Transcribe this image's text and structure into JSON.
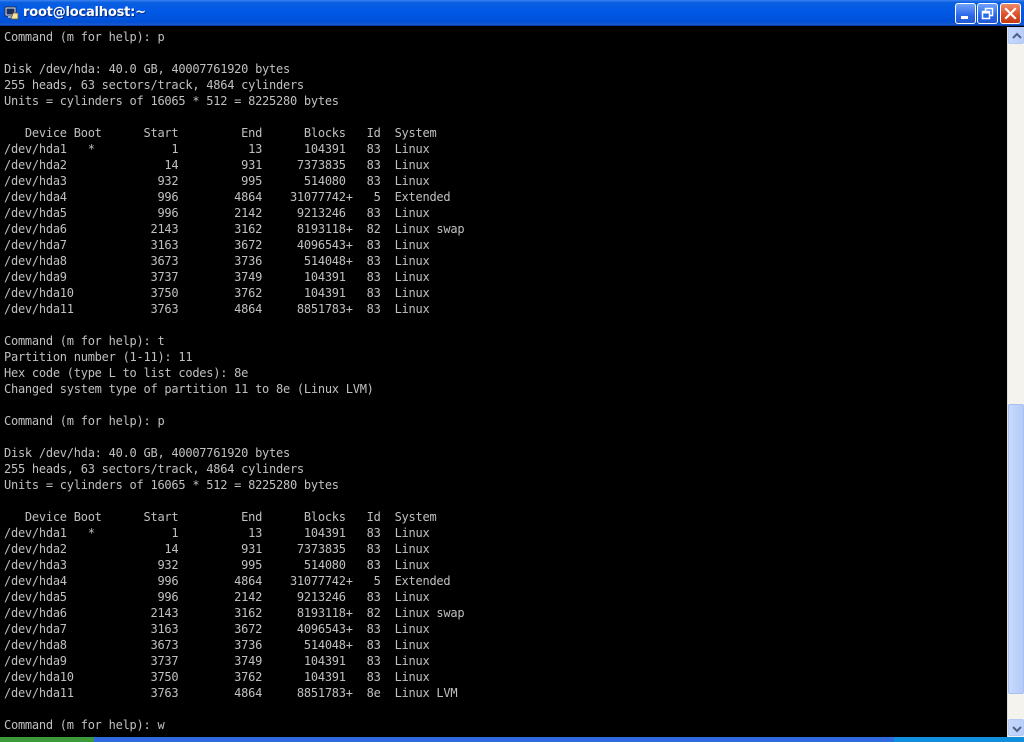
{
  "window": {
    "title": "root@localhost:~",
    "minimize_icon": "minimize-icon",
    "maximize_icon": "restore-icon",
    "close_icon": "close-icon"
  },
  "terminal": {
    "lines": [
      "Command (m for help): p",
      "",
      "Disk /dev/hda: 40.0 GB, 40007761920 bytes",
      "255 heads, 63 sectors/track, 4864 cylinders",
      "Units = cylinders of 16065 * 512 = 8225280 bytes",
      "",
      "   Device Boot      Start         End      Blocks   Id  System",
      "/dev/hda1   *           1          13      104391   83  Linux",
      "/dev/hda2              14         931     7373835   83  Linux",
      "/dev/hda3             932         995      514080   83  Linux",
      "/dev/hda4             996        4864    31077742+   5  Extended",
      "/dev/hda5             996        2142     9213246   83  Linux",
      "/dev/hda6            2143        3162     8193118+  82  Linux swap",
      "/dev/hda7            3163        3672     4096543+  83  Linux",
      "/dev/hda8            3673        3736      514048+  83  Linux",
      "/dev/hda9            3737        3749      104391   83  Linux",
      "/dev/hda10           3750        3762      104391   83  Linux",
      "/dev/hda11           3763        4864     8851783+  83  Linux",
      "",
      "Command (m for help): t",
      "Partition number (1-11): 11",
      "Hex code (type L to list codes): 8e",
      "Changed system type of partition 11 to 8e (Linux LVM)",
      "",
      "Command (m for help): p",
      "",
      "Disk /dev/hda: 40.0 GB, 40007761920 bytes",
      "255 heads, 63 sectors/track, 4864 cylinders",
      "Units = cylinders of 16065 * 512 = 8225280 bytes",
      "",
      "   Device Boot      Start         End      Blocks   Id  System",
      "/dev/hda1   *           1          13      104391   83  Linux",
      "/dev/hda2              14         931     7373835   83  Linux",
      "/dev/hda3             932         995      514080   83  Linux",
      "/dev/hda4             996        4864    31077742+   5  Extended",
      "/dev/hda5             996        2142     9213246   83  Linux",
      "/dev/hda6            2143        3162     8193118+  82  Linux swap",
      "/dev/hda7            3163        3672     4096543+  83  Linux",
      "/dev/hda8            3673        3736      514048+  83  Linux",
      "/dev/hda9            3737        3749      104391   83  Linux",
      "/dev/hda10           3750        3762      104391   83  Linux",
      "/dev/hda11           3763        4864     8851783+  8e  Linux LVM",
      "",
      "Command (m for help): w"
    ]
  },
  "scrollbar": {
    "up_icon": "arrow-up-icon",
    "down_icon": "arrow-down-icon",
    "position": 0.96
  },
  "colors": {
    "terminal_background": "#000000",
    "terminal_text": "#c0c0c0",
    "titlebar": "#0058e6"
  }
}
